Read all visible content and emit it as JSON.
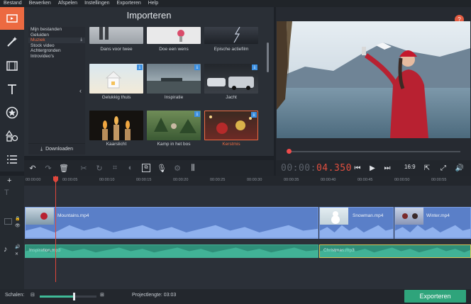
{
  "menu": [
    "Bestand",
    "Bewerken",
    "Afspelen",
    "Instellingen",
    "Exporteren",
    "Help"
  ],
  "import_panel": {
    "title": "Importeren",
    "categories": [
      {
        "label": "Mijn bestanden",
        "active": false
      },
      {
        "label": "Geluiden",
        "active": false
      },
      {
        "label": "Muziek",
        "active": true
      },
      {
        "label": "Stock video",
        "active": false
      },
      {
        "label": "Achtergronden",
        "active": false
      },
      {
        "label": "Introvideo's",
        "active": false
      }
    ],
    "download_label": "Downloaden",
    "thumbnails": [
      {
        "label": "Dans voor twee",
        "starred": false,
        "selected": false
      },
      {
        "label": "Doe een wens",
        "starred": false,
        "selected": false
      },
      {
        "label": "Epische actiefilm",
        "starred": false,
        "selected": false
      },
      {
        "label": "Gelukkig thuis",
        "starred": true,
        "selected": false
      },
      {
        "label": "Inspiratie",
        "starred": true,
        "selected": false
      },
      {
        "label": "Jacht",
        "starred": true,
        "selected": false
      },
      {
        "label": "Kaarslicht",
        "starred": false,
        "selected": false
      },
      {
        "label": "Kamp in het bos",
        "starred": true,
        "selected": false
      },
      {
        "label": "Kerstmis",
        "starred": true,
        "selected": true
      }
    ]
  },
  "preview": {
    "help": "?",
    "timecode_dim": "00:00:",
    "timecode_cur": "04.350",
    "aspect": "16:9"
  },
  "ruler_ticks": [
    "00:00:00",
    "00:00:05",
    "00:00:10",
    "00:00:15",
    "00:00:20",
    "00:00:25",
    "00:00:30",
    "00:00:35",
    "00:00:40",
    "00:00:45",
    "00:00:50",
    "00:00:55"
  ],
  "video_clips": [
    {
      "name": "Mountains.mp4"
    },
    {
      "name": "Snowman.mp4"
    },
    {
      "name": "Winter.mp4"
    }
  ],
  "audio_clips": [
    {
      "name": "Inspiration.mp3"
    },
    {
      "name": "Christmas.mp3"
    }
  ],
  "footer": {
    "zoom_label": "Schalen:",
    "zoom_level": 0.6,
    "project_length": "Projectlengte:  03:03",
    "export_label": "Exporteren"
  },
  "colors": {
    "accent": "#ee6c43",
    "video_clip": "#5a7fc8",
    "audio_clip": "#2f8f79",
    "export": "#2fa47b"
  }
}
